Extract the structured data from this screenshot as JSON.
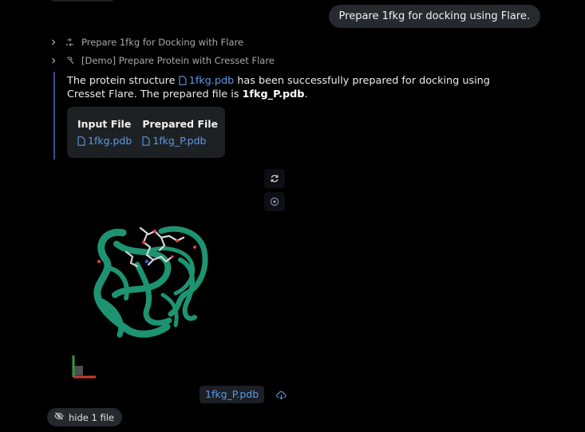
{
  "user_message": "Prepare 1fkg for docking using Flare.",
  "tool_calls": [
    {
      "label": "Prepare 1fkg for Docking with Flare",
      "icon": "workflow-icon"
    },
    {
      "label": "[Demo] Prepare Protein with Cresset Flare",
      "icon": "hammer-icon"
    }
  ],
  "answer": {
    "prefix": "The protein structure ",
    "file_link": "1fkg.pdb",
    "middle": " has been successfully prepared for docking using Cresset Flare. The prepared file is ",
    "prepared_file": "1fkg_P.pdb",
    "suffix": "."
  },
  "file_table": {
    "headers": [
      "Input File",
      "Prepared File"
    ],
    "rows": [
      [
        "1fkg.pdb",
        "1fkg_P.pdb"
      ]
    ]
  },
  "viewer": {
    "controls": [
      "refresh-icon",
      "focus-icon"
    ],
    "file_name": "1fkg_P.pdb",
    "ribbon_color": "#1e9371"
  },
  "hide_files_label": "hide 1 file",
  "colors": {
    "link": "#5b9ae8",
    "accent_bar": "#3d4f8f",
    "background": "#000000"
  }
}
